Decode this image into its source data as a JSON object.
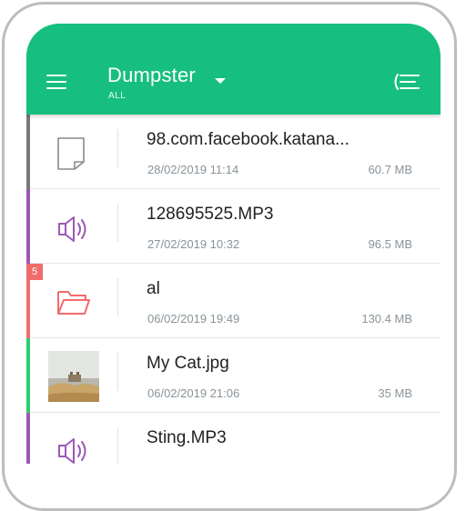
{
  "app_bar": {
    "title": "Dumpster",
    "subtitle": "ALL",
    "menu_icon": "hamburger-menu-icon",
    "sort_icon": "sort-icon",
    "background": "#17bf7f"
  },
  "files": [
    {
      "name": "98.com.facebook.katana...",
      "date": "28/02/2019  11:14",
      "size": "60.7 MB",
      "type": "document",
      "icon": "document-icon",
      "stripe_color": "#7a7a7a"
    },
    {
      "name": "128695525.MP3",
      "date": "27/02/2019  10:32",
      "size": "96.5 MB",
      "type": "audio",
      "icon": "speaker-icon",
      "stripe_color": "#9b59b6"
    },
    {
      "name": "al",
      "date": "06/02/2019  19:49",
      "size": "130.4 MB",
      "type": "folder",
      "icon": "folder-icon",
      "stripe_color": "#f16c6c",
      "badge": "5"
    },
    {
      "name": "My Cat.jpg",
      "date": "06/02/2019  21:06",
      "size": "35 MB",
      "type": "image",
      "icon": "image-thumbnail",
      "stripe_color": "#2ecc71"
    },
    {
      "name": "Sting.MP3",
      "date": "",
      "size": "",
      "type": "audio",
      "icon": "speaker-icon",
      "stripe_color": "#9b59b6"
    }
  ]
}
